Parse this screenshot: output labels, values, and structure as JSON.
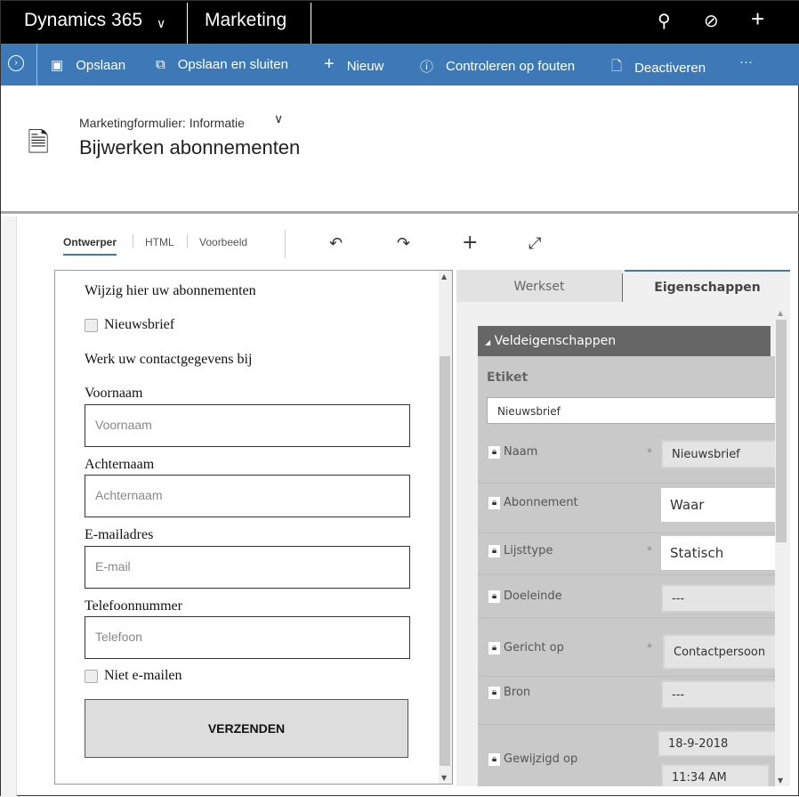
{
  "topbar": {
    "app": "Dynamics 365",
    "module": "Marketing"
  },
  "commands": [
    {
      "icon": "save-icon",
      "label": "Opslaan"
    },
    {
      "icon": "save-close-icon",
      "label": "Opslaan en sluiten"
    },
    {
      "icon": "plus-icon",
      "label": "Nieuw"
    },
    {
      "icon": "check-errors-icon",
      "label": "Controleren op fouten"
    },
    {
      "icon": "deactivate-icon",
      "label": "Deactiveren"
    }
  ],
  "more": "···",
  "header": {
    "form_selector": "Marketingformulier: Informatie",
    "title": "Bijwerken abonnementen"
  },
  "designer_tabs": [
    "Ontwerper",
    "HTML",
    "Voorbeeld"
  ],
  "form": {
    "heading1": "Wijzig hier uw abonnementen",
    "newsletter": "Nieuwsbrief",
    "heading2": "Werk uw contactgegevens bij",
    "fields": [
      {
        "label": "Voornaam",
        "placeholder": "Voornaam"
      },
      {
        "label": "Achternaam",
        "placeholder": "Achternaam"
      },
      {
        "label": "E-mailadres",
        "placeholder": "E-mail"
      },
      {
        "label": "Telefoonnummer",
        "placeholder": "Telefoon"
      }
    ],
    "no_email": "Niet e-mailen",
    "submit": "VERZENDEN"
  },
  "panel": {
    "tabs": [
      "Werkset",
      "Eigenschappen"
    ],
    "active_tab": "Eigenschappen",
    "section": "Veldeigenschappen",
    "etiket_label": "Etiket",
    "etiket_value": "Nieuwsbrief",
    "props": [
      {
        "label": "Naam",
        "value": "Nieuwsbrief",
        "required": "*"
      },
      {
        "label": "Abonnement",
        "value": "Waar"
      },
      {
        "label": "Lijsttype",
        "value": "Statisch",
        "required": "*"
      },
      {
        "label": "Doeleinde",
        "value": "---"
      },
      {
        "label": "Gericht op",
        "value": "Contactpersoon",
        "required": "*"
      },
      {
        "label": "Bron",
        "value": "---"
      },
      {
        "label": "Gewijzigd op",
        "date": "18-9-2018",
        "time": "11:34 AM"
      }
    ]
  },
  "colors": {
    "command_bar": "#3c79b6",
    "top_bar": "#000000",
    "section_header": "#666666"
  }
}
